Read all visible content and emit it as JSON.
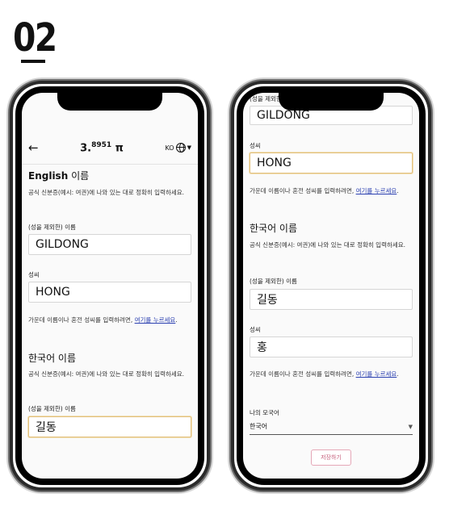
{
  "step": {
    "number": "02"
  },
  "left_screen": {
    "header": {
      "back_icon": "←",
      "balance": "3.",
      "balance_sup": "8951",
      "balance_unit": " π",
      "lang": "KO"
    },
    "english": {
      "title_bold": "English",
      "title_light": " 이름",
      "desc": "공식 신분증(예시: 여권)에 나와 있는 대로 정확히 입력하세요.",
      "given_label": "(성을 제외한) 이름",
      "given_value": "GILDONG",
      "family_label": "성씨",
      "family_value": "HONG",
      "hint_text": "가운데 이름이나 혼전 성씨를 입력하려면, ",
      "hint_link": "여기를 누르세요",
      "hint_end": "."
    },
    "korean": {
      "title": "한국어 이름",
      "desc": "공식 신분증(예시: 여권)에 나와 있는 대로 정확히 입력하세요.",
      "given_label": "(성을 제외한) 이름",
      "given_value": "길동"
    }
  },
  "right_screen": {
    "cut_label": "(성을 제외한)",
    "english_given_value": "GILDONG",
    "english_family_label": "성씨",
    "english_family_value": "HONG",
    "hint_text": "가운데 이름이나 혼전 성씨를 입력하려면, ",
    "hint_link": "여기를 누르세요",
    "hint_end": ".",
    "korean": {
      "title": "한국어 이름",
      "desc": "공식 신분증(예시: 여권)에 나와 있는 대로 정확히 입력하세요.",
      "given_label": "(성을 제외한) 이름",
      "given_value": "길동",
      "family_label": "성씨",
      "family_value": "홍",
      "hint_text": "가운데 이름이나 혼전 성씨를 입력하려면, ",
      "hint_link": "여기를 누르세요",
      "hint_end": "."
    },
    "native_language": {
      "label": "나의 모국어",
      "value": "한국어"
    },
    "save_button": "저장하기"
  }
}
